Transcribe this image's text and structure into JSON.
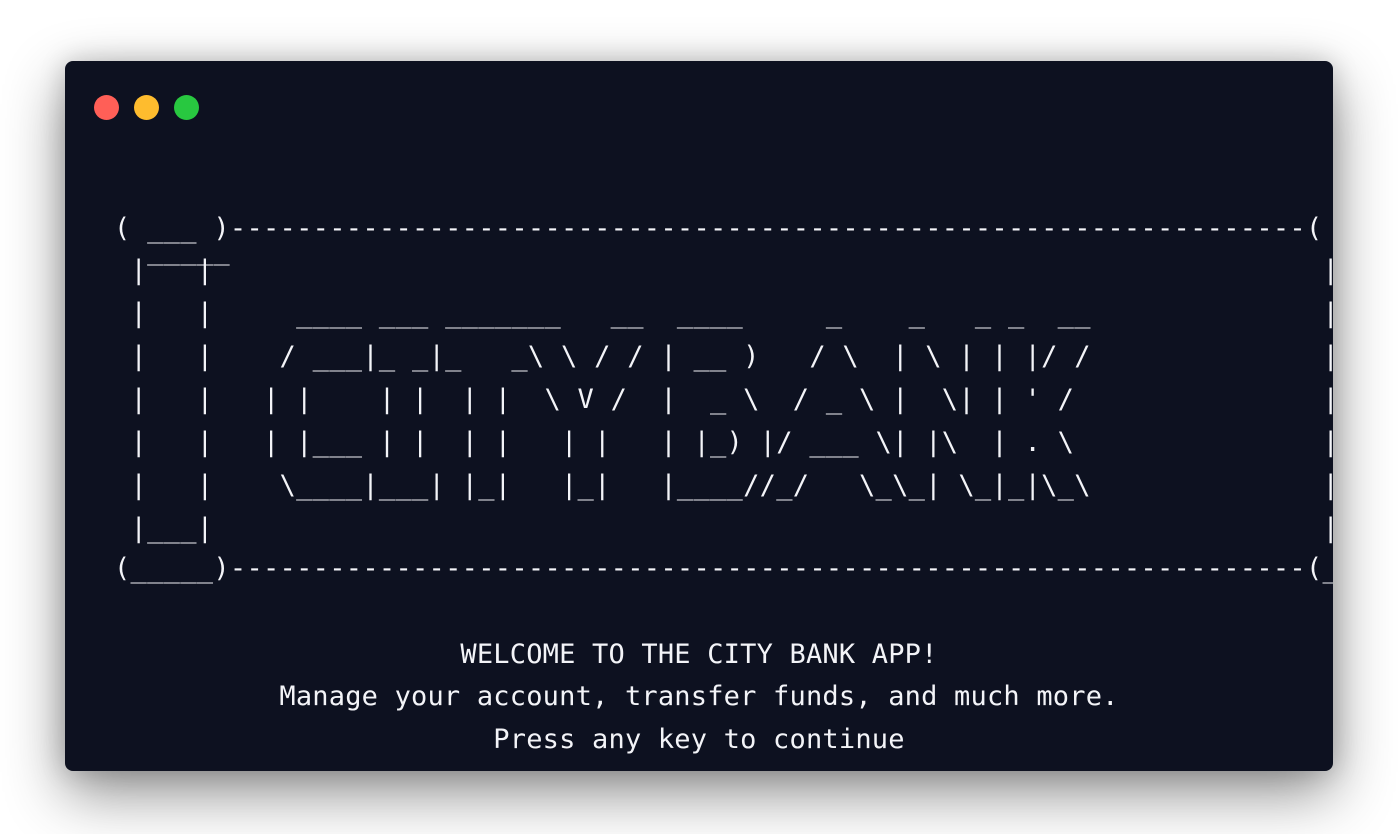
{
  "window": {
    "controls": [
      {
        "name": "close",
        "color": "#ff5f57"
      },
      {
        "name": "minimize",
        "color": "#febc2e"
      },
      {
        "name": "maximize",
        "color": "#28c840"
      }
    ]
  },
  "banner": {
    "lines": [
      "  _____                                                                   _____",
      "( ___ )-----------------------------------------------------------------( ___ )",
      " |   |                                                                   |   |",
      " |   |     ____ ___ _______   __  ____     _    _   _ _  __              |   |",
      " |   |    / ___|_ _|_   _\\ \\ / / | __ )   / \\  | \\ | | |/ /              |   |",
      " |   |   | |    | |  | |  \\ V /  |  _ \\  / _ \\ |  \\| | ' /               |   |",
      " |   |   | |___ | |  | |   | |   | |_) |/ ___ \\| |\\  | . \\               |   |",
      " |   |    \\____|___| |_|   |_|   |____//_/   \\_\\_| \\_|_|\\_\\              |   |",
      " |___|                                                                   |___|",
      "(_____)-----------------------------------------------------------------(_____)"
    ]
  },
  "messages": {
    "welcome": "WELCOME TO THE CITY BANK APP!",
    "tagline": "Manage your account, transfer funds, and much more.",
    "prompt": "Press any key to continue"
  }
}
